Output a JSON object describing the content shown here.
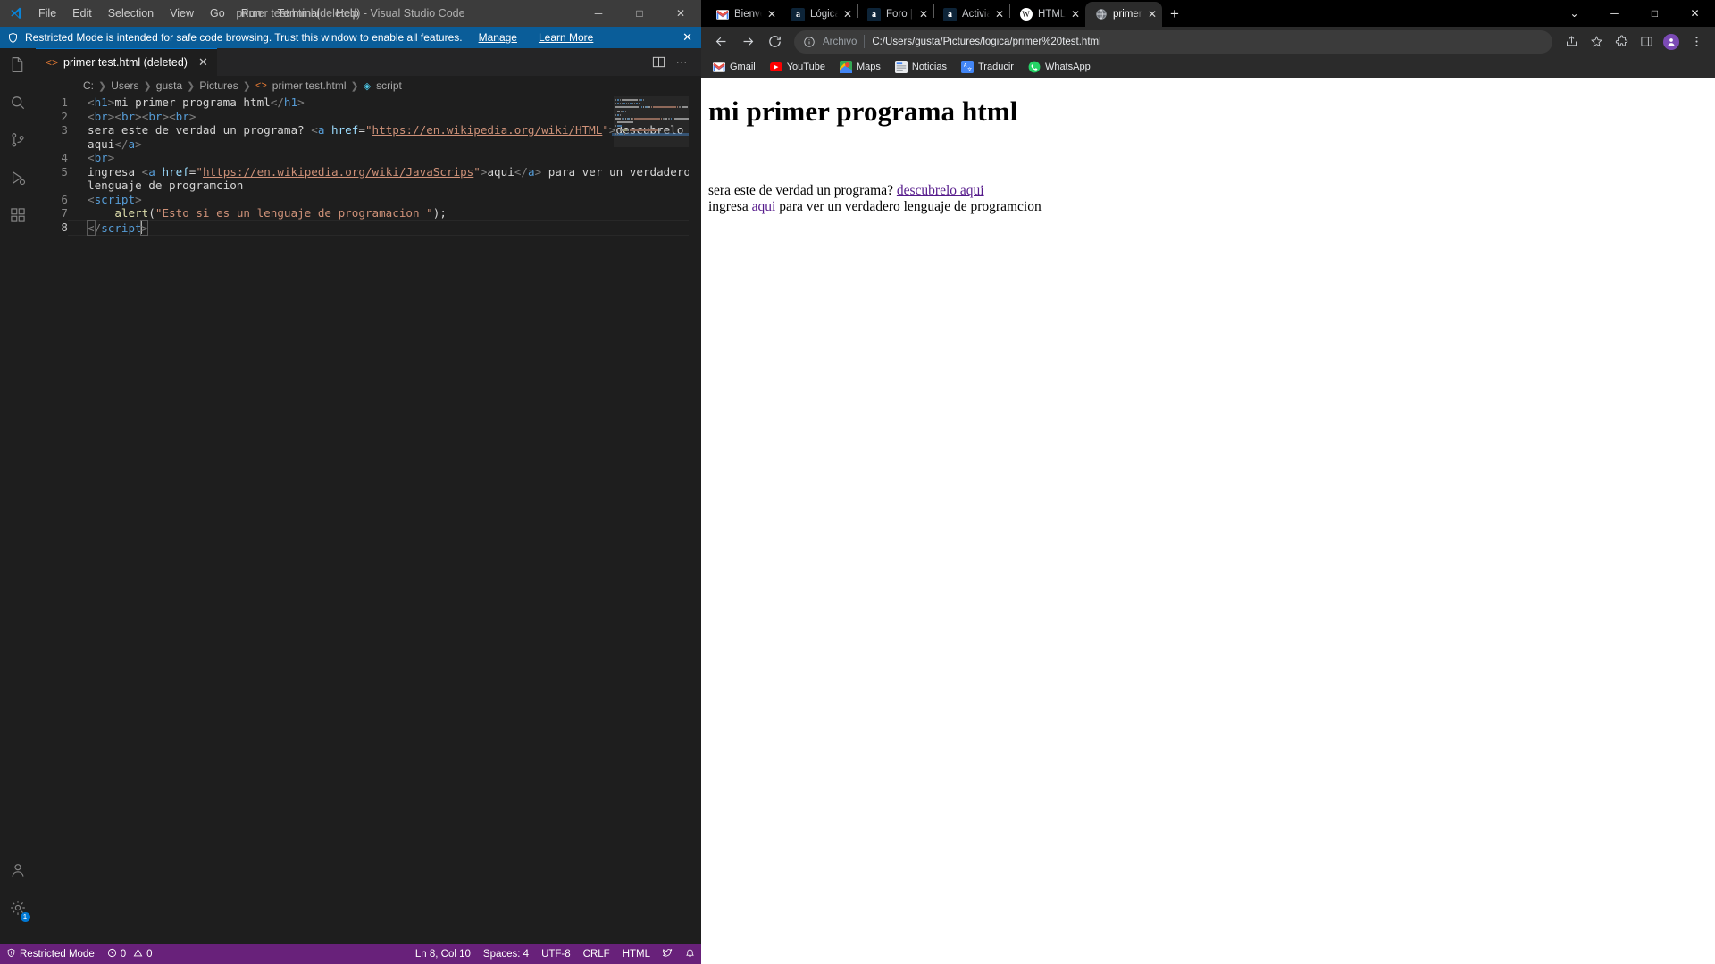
{
  "vscode": {
    "title": "primer test.html (deleted) - Visual Studio Code",
    "menu": [
      "File",
      "Edit",
      "Selection",
      "View",
      "Go",
      "Run",
      "Terminal",
      "Help"
    ],
    "window_buttons": {
      "minimize": "─",
      "maximize": "□",
      "close": "✕"
    },
    "banner": {
      "icon": "shield-icon",
      "text": "Restricted Mode is intended for safe code browsing. Trust this window to enable all features.",
      "manage_label": "Manage",
      "learn_more_label": "Learn More",
      "close_label": "✕",
      "background": "#0a5d99"
    },
    "activity_bar": [
      {
        "name": "explorer",
        "icon": "files-icon",
        "active": false
      },
      {
        "name": "search",
        "icon": "search-icon",
        "active": false
      },
      {
        "name": "source-control",
        "icon": "source-control-icon",
        "active": false
      },
      {
        "name": "run-and-debug",
        "icon": "run-debug-icon",
        "active": false
      },
      {
        "name": "extensions",
        "icon": "extensions-icon",
        "active": false
      }
    ],
    "activity_bar_bottom": [
      {
        "name": "accounts",
        "icon": "account-icon",
        "badge": ""
      },
      {
        "name": "manage",
        "icon": "gear-icon",
        "badge": "1"
      }
    ],
    "tab": {
      "label": "primer test.html (deleted)",
      "icon": "html-file-icon",
      "close": "✕"
    },
    "tab_actions": [
      {
        "name": "split-editor",
        "icon": "split-editor-icon"
      },
      {
        "name": "more-actions",
        "icon": "ellipsis-icon"
      }
    ],
    "breadcrumb": [
      "C:",
      "Users",
      "gusta",
      "Pictures",
      "primer test.html",
      "script"
    ],
    "code_lines": [
      {
        "number": "1",
        "tokens": [
          {
            "t": "brack",
            "v": "<"
          },
          {
            "t": "tag",
            "v": "h1"
          },
          {
            "t": "brack",
            "v": ">"
          },
          {
            "t": "txt",
            "v": "mi primer programa html"
          },
          {
            "t": "brack",
            "v": "</"
          },
          {
            "t": "tag",
            "v": "h1"
          },
          {
            "t": "brack",
            "v": ">"
          }
        ]
      },
      {
        "number": "2",
        "tokens": [
          {
            "t": "brack",
            "v": "<"
          },
          {
            "t": "tag",
            "v": "br"
          },
          {
            "t": "brack",
            "v": ">"
          },
          {
            "t": "brack",
            "v": "<"
          },
          {
            "t": "tag",
            "v": "br"
          },
          {
            "t": "brack",
            "v": ">"
          },
          {
            "t": "brack",
            "v": "<"
          },
          {
            "t": "tag",
            "v": "br"
          },
          {
            "t": "brack",
            "v": ">"
          },
          {
            "t": "brack",
            "v": "<"
          },
          {
            "t": "tag",
            "v": "br"
          },
          {
            "t": "brack",
            "v": ">"
          }
        ]
      },
      {
        "number": "3",
        "tokens": [
          {
            "t": "txt",
            "v": "sera este de verdad un programa? "
          },
          {
            "t": "brack",
            "v": "<"
          },
          {
            "t": "tag",
            "v": "a"
          },
          {
            "t": "txt",
            "v": " "
          },
          {
            "t": "attr",
            "v": "href"
          },
          {
            "t": "punc",
            "v": "="
          },
          {
            "t": "str",
            "v": "\""
          },
          {
            "t": "link",
            "v": "https://en.wikipedia.org/wiki/HTML"
          },
          {
            "t": "str",
            "v": "\""
          },
          {
            "t": "brack",
            "v": ">"
          },
          {
            "t": "txt",
            "v": "descubrelo"
          }
        ]
      },
      {
        "number": "",
        "wrapped": true,
        "tokens": [
          {
            "t": "txt",
            "v": "aqui"
          },
          {
            "t": "brack",
            "v": "</"
          },
          {
            "t": "tag",
            "v": "a"
          },
          {
            "t": "brack",
            "v": ">"
          }
        ]
      },
      {
        "number": "4",
        "tokens": [
          {
            "t": "brack",
            "v": "<"
          },
          {
            "t": "tag",
            "v": "br"
          },
          {
            "t": "brack",
            "v": ">"
          }
        ]
      },
      {
        "number": "5",
        "tokens": [
          {
            "t": "txt",
            "v": "ingresa "
          },
          {
            "t": "brack",
            "v": "<"
          },
          {
            "t": "tag",
            "v": "a"
          },
          {
            "t": "txt",
            "v": " "
          },
          {
            "t": "attr",
            "v": "href"
          },
          {
            "t": "punc",
            "v": "="
          },
          {
            "t": "str",
            "v": "\""
          },
          {
            "t": "link",
            "v": "https://en.wikipedia.org/wiki/JavaScrips"
          },
          {
            "t": "str",
            "v": "\""
          },
          {
            "t": "brack",
            "v": ">"
          },
          {
            "t": "txt",
            "v": "aqui"
          },
          {
            "t": "brack",
            "v": "</"
          },
          {
            "t": "tag",
            "v": "a"
          },
          {
            "t": "brack",
            "v": ">"
          },
          {
            "t": "txt",
            "v": " para ver un verdadero"
          }
        ]
      },
      {
        "number": "",
        "wrapped": true,
        "tokens": [
          {
            "t": "txt",
            "v": "lenguaje de programcion"
          }
        ]
      },
      {
        "number": "6",
        "tokens": [
          {
            "t": "brack",
            "v": "<"
          },
          {
            "t": "tag",
            "v": "script"
          },
          {
            "t": "brack",
            "v": ">"
          }
        ]
      },
      {
        "number": "7",
        "indent": true,
        "tokens": [
          {
            "t": "txt",
            "v": "    "
          },
          {
            "t": "fn",
            "v": "alert"
          },
          {
            "t": "punc",
            "v": "("
          },
          {
            "t": "str",
            "v": "\"Esto si es un lenguaje de programacion \""
          },
          {
            "t": "punc",
            "v": ");"
          }
        ]
      },
      {
        "number": "8",
        "current": true,
        "tokens": [
          {
            "t": "brack-hl",
            "v": "<"
          },
          {
            "t": "brack",
            "v": "/"
          },
          {
            "t": "tag",
            "v": "script"
          },
          {
            "t": "caret",
            "v": ""
          },
          {
            "t": "brack-hl",
            "v": ">"
          }
        ]
      }
    ],
    "status_bar": {
      "background": "#68217a",
      "left": [
        {
          "name": "restricted-mode",
          "icon": "shield-icon",
          "label": "Restricted Mode"
        },
        {
          "name": "problems",
          "icon": "error-warning-icon",
          "label": "0  0",
          "errors": "0",
          "warnings": "0"
        }
      ],
      "right": [
        {
          "name": "cursor-position",
          "label": "Ln 8, Col 10"
        },
        {
          "name": "indentation",
          "label": "Spaces: 4"
        },
        {
          "name": "encoding",
          "label": "UTF-8"
        },
        {
          "name": "eol",
          "label": "CRLF"
        },
        {
          "name": "language-mode",
          "label": "HTML"
        },
        {
          "name": "feedback",
          "icon": "tweet-icon",
          "label": ""
        },
        {
          "name": "notifications",
          "icon": "bell-icon",
          "label": ""
        }
      ]
    }
  },
  "chrome": {
    "tabs": [
      {
        "label": "Bienvenido",
        "favicon": "gmail-icon",
        "active": false
      },
      {
        "label": "Lógica de",
        "favicon": "alura-icon",
        "active": false
      },
      {
        "label": "Foro | Alu",
        "favicon": "alura-icon",
        "active": false
      },
      {
        "label": "Activiad d",
        "favicon": "alura-icon",
        "active": false
      },
      {
        "label": "HTML - W",
        "favicon": "wikipedia-icon",
        "active": false
      },
      {
        "label": "primer te",
        "favicon": "globe-icon",
        "active": true
      }
    ],
    "tab_close_label": "✕",
    "new_tab_label": "+",
    "window_controls": {
      "chevron": "⌄",
      "minimize": "─",
      "maximize": "□",
      "close": "✕"
    },
    "toolbar": {
      "back": "back-arrow-icon",
      "forward": "forward-arrow-icon",
      "reload": "reload-icon",
      "scheme_label": "Archivo",
      "url": "C:/Users/gusta/Pictures/logica/primer%20test.html",
      "share_icon": "share-icon",
      "bookmark_icon": "star-icon",
      "extensions_icon": "puzzle-icon",
      "sidepanel_icon": "side-panel-icon",
      "profile_icon": "avatar-icon",
      "menu_icon": "three-dot-menu-icon"
    },
    "bookmarks": [
      {
        "label": "Gmail",
        "icon": "gmail-icon"
      },
      {
        "label": "YouTube",
        "icon": "youtube-icon"
      },
      {
        "label": "Maps",
        "icon": "maps-icon"
      },
      {
        "label": "Noticias",
        "icon": "news-icon"
      },
      {
        "label": "Traducir",
        "icon": "translate-icon"
      },
      {
        "label": "WhatsApp",
        "icon": "whatsapp-icon"
      }
    ],
    "page": {
      "heading": "mi primer programa html",
      "para1_before": "sera este de verdad un programa? ",
      "para1_link": "descubrelo aqui",
      "para2_before": "ingresa ",
      "para2_link": "aqui",
      "para2_after": " para ver un verdadero lenguaje de programcion"
    }
  }
}
